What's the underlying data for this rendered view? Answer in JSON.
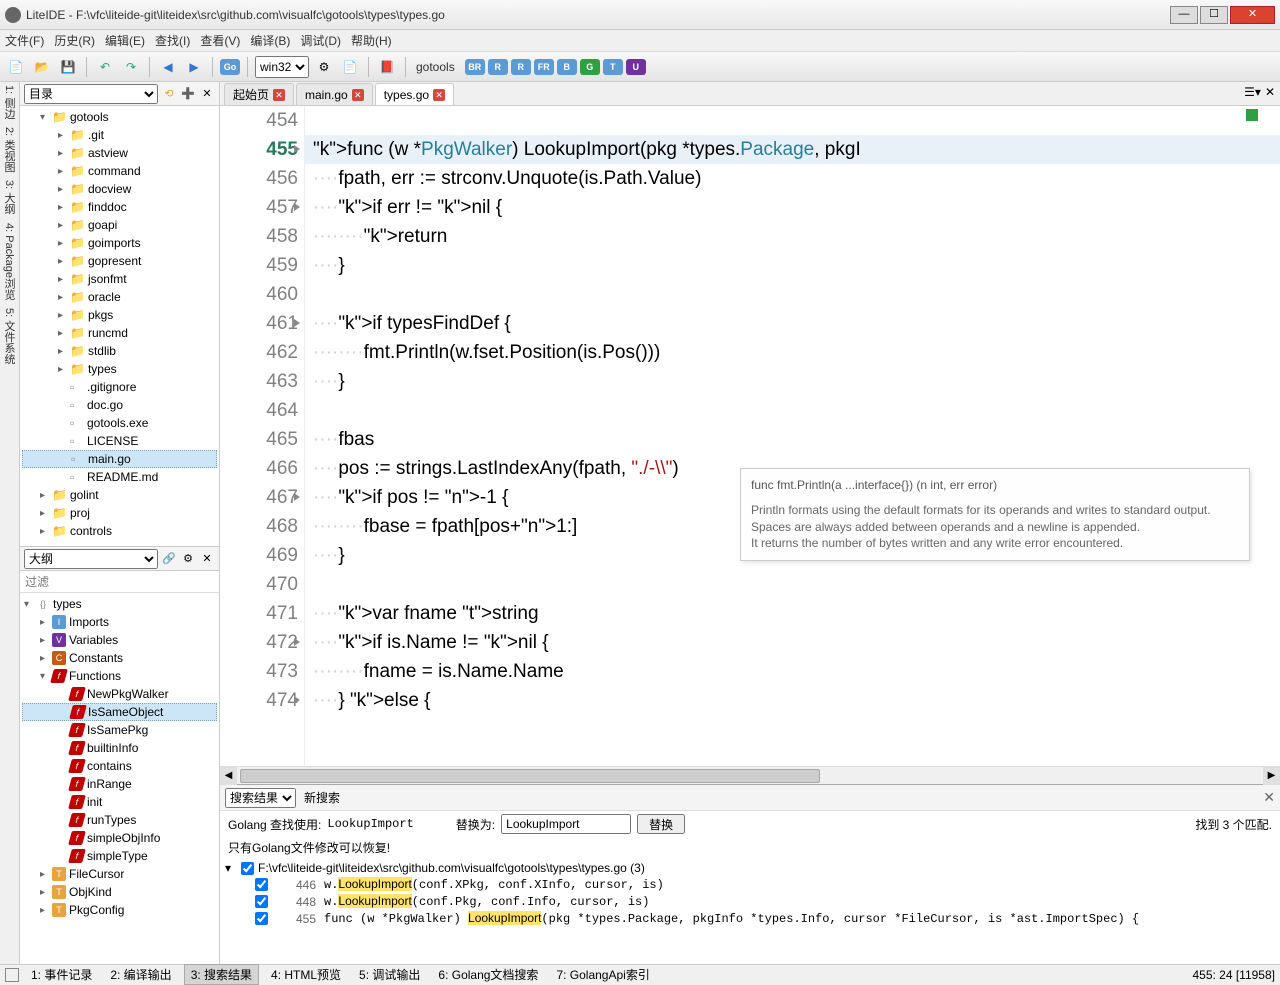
{
  "window": {
    "title": "LiteIDE - F:\\vfc\\liteide-git\\liteidex\\src\\github.com\\visualfc\\gotools\\types\\types.go"
  },
  "menu": [
    "文件(F)",
    "历史(R)",
    "编辑(E)",
    "查找(I)",
    "查看(V)",
    "编译(B)",
    "调试(D)",
    "帮助(H)"
  ],
  "toolbar": {
    "env_select": "win32",
    "target_label": "gotools",
    "gobtns": [
      "BR",
      "R",
      "R",
      "FR",
      "B",
      "G",
      "T",
      "U"
    ]
  },
  "dir_panel": {
    "label": "目录",
    "tree": [
      {
        "l": 1,
        "t": "folder",
        "arrow": "▾",
        "name": "gotools"
      },
      {
        "l": 2,
        "t": "folder",
        "arrow": "▸",
        "name": ".git"
      },
      {
        "l": 2,
        "t": "folder",
        "arrow": "▸",
        "name": "astview"
      },
      {
        "l": 2,
        "t": "folder",
        "arrow": "▸",
        "name": "command"
      },
      {
        "l": 2,
        "t": "folder",
        "arrow": "▸",
        "name": "docview"
      },
      {
        "l": 2,
        "t": "folder",
        "arrow": "▸",
        "name": "finddoc"
      },
      {
        "l": 2,
        "t": "folder",
        "arrow": "▸",
        "name": "goapi"
      },
      {
        "l": 2,
        "t": "folder",
        "arrow": "▸",
        "name": "goimports"
      },
      {
        "l": 2,
        "t": "folder",
        "arrow": "▸",
        "name": "gopresent"
      },
      {
        "l": 2,
        "t": "folder",
        "arrow": "▸",
        "name": "jsonfmt"
      },
      {
        "l": 2,
        "t": "folder",
        "arrow": "▸",
        "name": "oracle"
      },
      {
        "l": 2,
        "t": "folder",
        "arrow": "▸",
        "name": "pkgs"
      },
      {
        "l": 2,
        "t": "folder",
        "arrow": "▸",
        "name": "runcmd"
      },
      {
        "l": 2,
        "t": "folder",
        "arrow": "▸",
        "name": "stdlib"
      },
      {
        "l": 2,
        "t": "folder",
        "arrow": "▸",
        "name": "types"
      },
      {
        "l": 2,
        "t": "file",
        "name": ".gitignore"
      },
      {
        "l": 2,
        "t": "file",
        "name": "doc.go"
      },
      {
        "l": 2,
        "t": "file",
        "name": "gotools.exe"
      },
      {
        "l": 2,
        "t": "file",
        "name": "LICENSE"
      },
      {
        "l": 2,
        "t": "file",
        "name": "main.go",
        "selected": true
      },
      {
        "l": 2,
        "t": "file",
        "name": "README.md"
      },
      {
        "l": 1,
        "t": "folder",
        "arrow": "▸",
        "name": "golint"
      },
      {
        "l": 1,
        "t": "folder",
        "arrow": "▸",
        "name": "proj"
      },
      {
        "l": 1,
        "t": "folder",
        "arrow": "▸",
        "name": "controls"
      }
    ]
  },
  "outline_panel": {
    "label": "大纲",
    "filter_placeholder": "过滤",
    "items": [
      {
        "l": 0,
        "sym": "pkg",
        "arrow": "▾",
        "name": "types"
      },
      {
        "l": 1,
        "sym": "imp",
        "arrow": "▸",
        "name": "Imports"
      },
      {
        "l": 1,
        "sym": "var",
        "arrow": "▸",
        "name": "Variables"
      },
      {
        "l": 1,
        "sym": "con",
        "arrow": "▸",
        "name": "Constants"
      },
      {
        "l": 1,
        "sym": "fn",
        "arrow": "▾",
        "name": "Functions"
      },
      {
        "l": 2,
        "sym": "fn",
        "name": "NewPkgWalker"
      },
      {
        "l": 2,
        "sym": "fn",
        "name": "IsSameObject",
        "selected": true
      },
      {
        "l": 2,
        "sym": "fn",
        "name": "IsSamePkg"
      },
      {
        "l": 2,
        "sym": "fn",
        "name": "builtinInfo"
      },
      {
        "l": 2,
        "sym": "fn",
        "name": "contains"
      },
      {
        "l": 2,
        "sym": "fn",
        "name": "inRange"
      },
      {
        "l": 2,
        "sym": "fn",
        "name": "init"
      },
      {
        "l": 2,
        "sym": "fn",
        "name": "runTypes"
      },
      {
        "l": 2,
        "sym": "fn",
        "name": "simpleObjInfo"
      },
      {
        "l": 2,
        "sym": "fn",
        "name": "simpleType"
      },
      {
        "l": 1,
        "sym": "typ",
        "arrow": "▸",
        "name": "FileCursor"
      },
      {
        "l": 1,
        "sym": "typ",
        "arrow": "▸",
        "name": "ObjKind"
      },
      {
        "l": 1,
        "sym": "typ",
        "arrow": "▸",
        "name": "PkgConfig"
      }
    ]
  },
  "tabs": [
    {
      "label": "起始页",
      "close": true
    },
    {
      "label": "main.go",
      "close": true
    },
    {
      "label": "types.go",
      "close": true,
      "active": true
    }
  ],
  "code": {
    "start": 454,
    "lines": [
      "",
      "func (w *PkgWalker) LookupImport(pkg *types.Package, pkgI",
      "    fpath, err := strconv.Unquote(is.Path.Value)",
      "    if err != nil {",
      "        return",
      "    }",
      "",
      "    if typesFindDef {",
      "        fmt.Println(w.fset.Position(is.Pos()))",
      "    }",
      "",
      "    fbas",
      "    pos := strings.LastIndexAny(fpath, \"./-\\\\\")",
      "    if pos != -1 {",
      "        fbase = fpath[pos+1:]",
      "    }",
      "",
      "    var fname string",
      "    if is.Name != nil {",
      "        fname = is.Name.Name",
      "    } else {"
    ],
    "marks": [
      455,
      457,
      461,
      467,
      472,
      474
    ]
  },
  "tooltip": {
    "sig": "func fmt.Println(a ...interface{}) (n int, err error)",
    "body1": "Println formats using the default formats for its operands and writes to standard output.",
    "body2": "Spaces are always added between operands and a newline is appended.",
    "body3": "It returns the number of bytes written and any write error encountered."
  },
  "search": {
    "dropdown": "搜索结果",
    "new_search": "新搜索",
    "find_label": "Golang 查找使用:",
    "find_value": "LookupImport",
    "replace_label": "替换为:",
    "replace_value": "LookupImport",
    "replace_btn": "替换",
    "count_label": "找到 3 个匹配.",
    "info": "只有Golang文件修改可以恢复!",
    "file": "F:\\vfc\\liteide-git\\liteidex\\src\\github.com\\visualfc\\gotools\\types\\types.go (3)",
    "rows": [
      {
        "ln": "446",
        "pre": "w.",
        "m": "LookupImport",
        "post": "(conf.XPkg, conf.XInfo, cursor, is)"
      },
      {
        "ln": "448",
        "pre": "w.",
        "m": "LookupImport",
        "post": "(conf.Pkg, conf.Info, cursor, is)"
      },
      {
        "ln": "455",
        "pre": "func (w *PkgWalker) ",
        "m": "LookupImport",
        "post": "(pkg *types.Package, pkgInfo *types.Info, cursor *FileCursor, is *ast.ImportSpec) {"
      }
    ]
  },
  "statusbar": {
    "items": [
      "1: 事件记录",
      "2: 编译输出",
      "3: 搜索结果",
      "4: HTML预览",
      "5: 调试输出",
      "6: Golang文档搜索",
      "7: GolangApi索引"
    ],
    "active": 2,
    "pos": "455: 24 [11958]"
  },
  "sidetabs": [
    "1: 侧边",
    "2: 类视图",
    "3: 大纲",
    "4: Package浏览",
    "5: 文件系统"
  ]
}
